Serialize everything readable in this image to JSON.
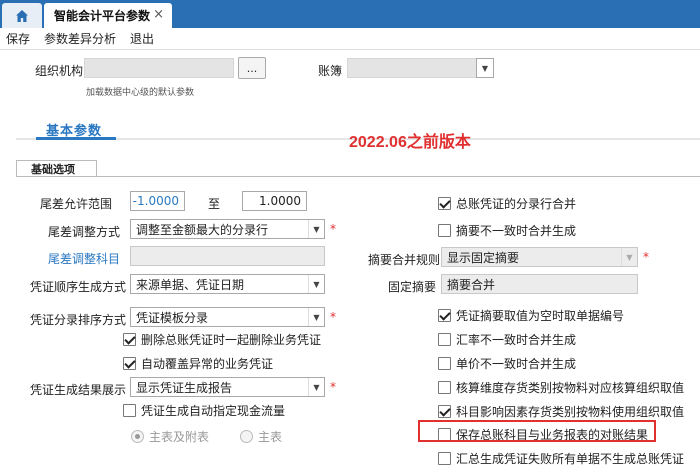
{
  "tabs": {
    "doc_tab_label": "智能会计平台参数",
    "close_glyph": "×"
  },
  "menu": {
    "save": "保存",
    "param_diff": "参数差异分析",
    "exit": "退出"
  },
  "header": {
    "org_label": "组织机构",
    "browse_label": "...",
    "org_hint": "加载数据中心级的默认参数",
    "ledger_label": "账簿"
  },
  "section": {
    "basic_tab": "基本参数",
    "version_note": "2022.06之前版本",
    "group_title": "基础选项"
  },
  "left": {
    "tolerance_label": "尾差允许范围",
    "tolerance_from": "-1.0000",
    "tolerance_to_label": "至",
    "tolerance_to": "1.0000",
    "adjust_mode_label": "尾差调整方式",
    "adjust_mode_value": "调整至金额最大的分录行",
    "adjust_account_label": "尾差调整科目",
    "voucher_seq_label": "凭证顺序生成方式",
    "voucher_seq_value": "来源单据、凭证日期",
    "entry_sort_label": "凭证分录排序方式",
    "entry_sort_value": "凭证模板分录",
    "delete_business_voucher": "删除总账凭证时一起删除业务凭证",
    "auto_overwrite": "自动覆盖异常的业务凭证",
    "result_display_label": "凭证生成结果展示",
    "result_display_value": "显示凭证生成报告",
    "cashflow_specify": "凭证生成自动指定现金流量",
    "radio_main_attached": "主表及附表",
    "radio_main": "主表"
  },
  "right": {
    "gl_merge": "总账凭证的分录行合并",
    "summary_diff_no_merge": "摘要不一致时合并生成",
    "summary_merge_rule_label": "摘要合并规则",
    "summary_merge_rule_value": "显示固定摘要",
    "fixed_summary_label": "固定摘要",
    "fixed_summary_value": "摘要合并",
    "summary_empty_take_doc": "凭证摘要取值为空时取单据编号",
    "rate_diff_merge": "汇率不一致时合并生成",
    "price_diff_merge": "单价不一致时合并生成",
    "dimension_stock_org": "核算维度存货类别按物料对应核算组织取值",
    "account_stock_org": "科目影响因素存货类别按物料使用组织取值",
    "save_gl_reconcile": "保存总账科目与业务报表的对账结果",
    "summary_failed_no_report": "汇总生成凭证失败所有单据不生成总账凭证"
  },
  "states": {
    "delete_business_voucher": true,
    "auto_overwrite": true,
    "cashflow_specify": false,
    "gl_merge": true,
    "summary_diff_no_merge": false,
    "summary_empty_take_doc": true,
    "rate_diff_merge": false,
    "price_diff_merge": false,
    "dimension_stock_org": false,
    "account_stock_org": true,
    "save_gl_reconcile": false,
    "summary_failed_no_report": false,
    "radio_selected": "main_attached"
  },
  "colors": {
    "tabbar": "#2a6fb3",
    "link_blue": "#2a78c2",
    "annotation_red": "#e03030"
  },
  "icons": {
    "home": "home-icon",
    "dropdown": "chevron-down-icon"
  }
}
